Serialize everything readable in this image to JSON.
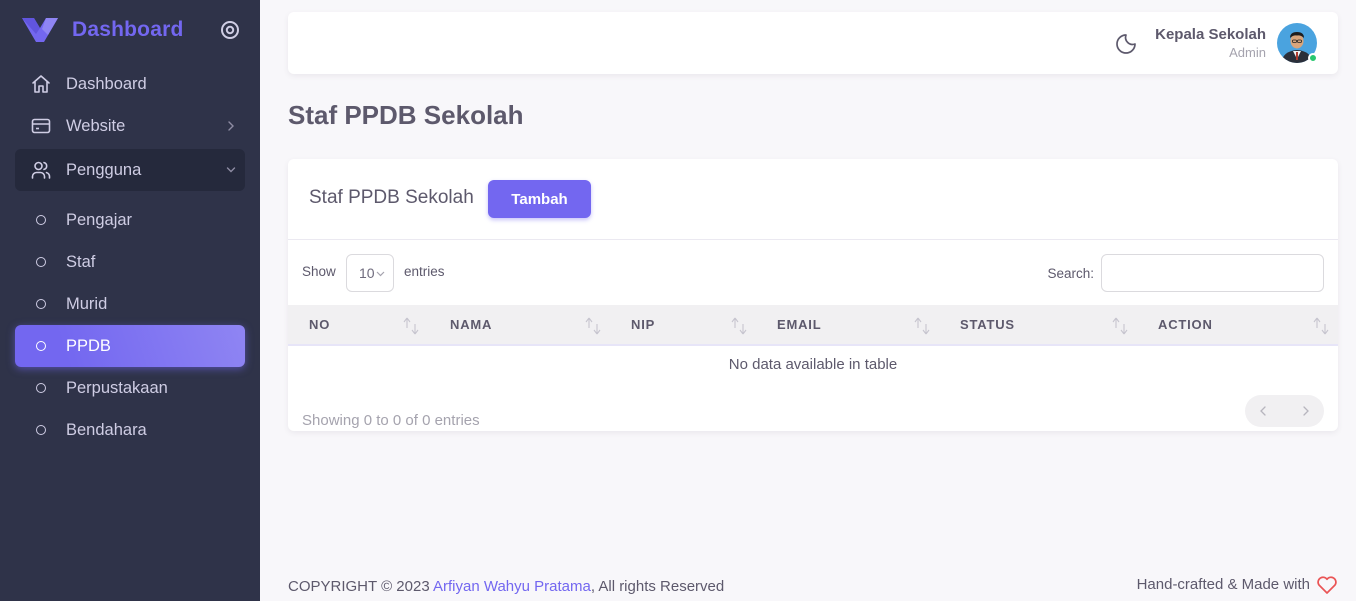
{
  "sidebar": {
    "brand": "Dashboard",
    "items": [
      {
        "label": "Dashboard"
      },
      {
        "label": "Website"
      },
      {
        "label": "Pengguna"
      }
    ],
    "subitems": [
      {
        "label": "Pengajar"
      },
      {
        "label": "Staf"
      },
      {
        "label": "Murid"
      },
      {
        "label": "PPDB"
      },
      {
        "label": "Perpustakaan"
      },
      {
        "label": "Bendahara"
      }
    ]
  },
  "navbar": {
    "user_name": "Kepala Sekolah",
    "user_role": "Admin"
  },
  "page": {
    "title": "Staf PPDB Sekolah"
  },
  "card": {
    "title": "Staf PPDB Sekolah",
    "add_button": "Tambah"
  },
  "table": {
    "show_label": "Show",
    "page_length": "10",
    "entries_label": "entries",
    "search_label": "Search:",
    "columns": [
      "NO",
      "NAMA",
      "NIP",
      "EMAIL",
      "STATUS",
      "ACTION"
    ],
    "empty_message": "No data available in table",
    "info": "Showing 0 to 0 of 0 entries"
  },
  "footer": {
    "copyright_prefix": "COPYRIGHT © 2023 ",
    "author": "Arfiyan Wahyu Pratama",
    "copyright_suffix": ", All rights Reserved",
    "made_with": "Hand-crafted & Made with"
  },
  "colors": {
    "primary": "#7367f0",
    "sidebar_bg": "#2f3349",
    "status_online": "#28c76f",
    "heart": "#ea5455"
  }
}
